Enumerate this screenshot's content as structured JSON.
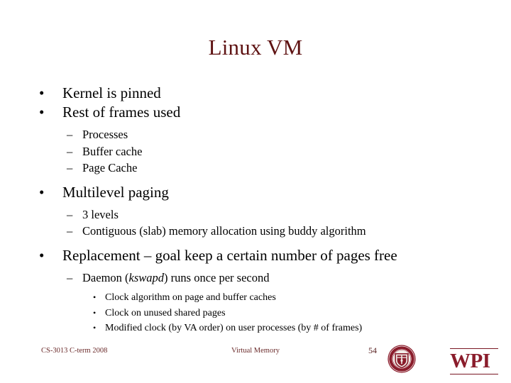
{
  "slide": {
    "title": "Linux VM",
    "title_color": "#5e1212",
    "background_color": "#ffffff",
    "body_text_color": "#000000",
    "bullets": [
      {
        "level": 1,
        "marker": "•",
        "text": "Kernel is pinned"
      },
      {
        "level": 1,
        "marker": "•",
        "text": "Rest of frames used"
      },
      {
        "level": 2,
        "marker": "–",
        "text": "Processes"
      },
      {
        "level": 2,
        "marker": "–",
        "text": "Buffer cache"
      },
      {
        "level": 2,
        "marker": "–",
        "text": "Page Cache"
      },
      {
        "level": 1,
        "marker": "•",
        "text": "Multilevel paging"
      },
      {
        "level": 2,
        "marker": "–",
        "text": "3 levels"
      },
      {
        "level": 2,
        "marker": "–",
        "text": "Contiguous (slab) memory allocation using buddy algorithm"
      },
      {
        "level": 1,
        "marker": "•",
        "text": "Replacement – goal keep a certain number of pages free"
      },
      {
        "level": 2,
        "marker": "–",
        "text_before": "Daemon (",
        "text_italic": "kswapd",
        "text_after": ") runs once per second"
      },
      {
        "level": 3,
        "marker": "•",
        "text": "Clock algorithm on page and buffer caches"
      },
      {
        "level": 3,
        "marker": "•",
        "text": "Clock on unused shared pages"
      },
      {
        "level": 3,
        "marker": "•",
        "text": "Modified clock (by VA order) on user processes (by # of frames)"
      }
    ]
  },
  "footer": {
    "left": "CS-3013 C-term 2008",
    "center": "Virtual Memory",
    "page_number": "54",
    "color": "#6b2b2b"
  },
  "logo": {
    "wordmark": "WPI",
    "seal_ring_text": "WORCESTER POLYTECHNIC INSTITUTE",
    "seal_year": "1865",
    "crimson": "#8a1c2b"
  }
}
